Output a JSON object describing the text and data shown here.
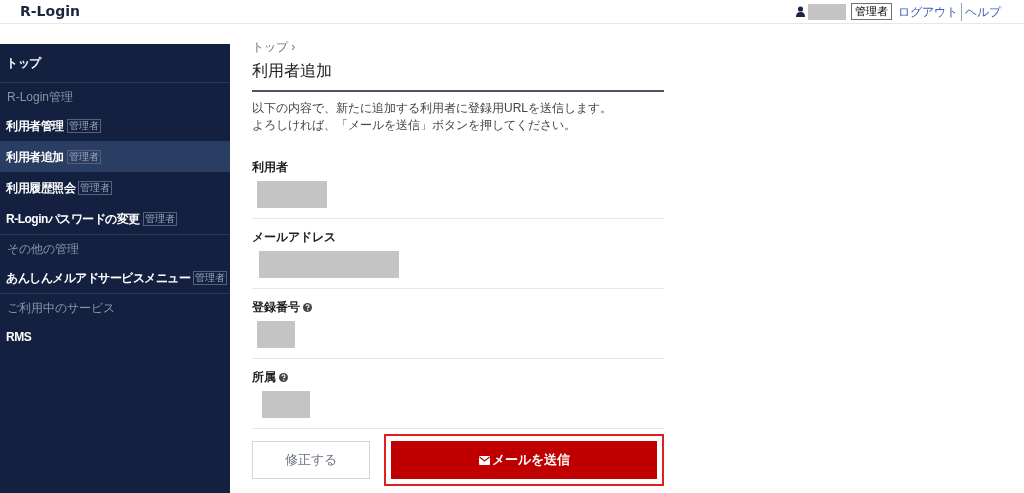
{
  "header": {
    "logo": "R-Login",
    "role_badge": "管理者",
    "links": [
      "ログアウト",
      "ヘルプ"
    ]
  },
  "sidebar": {
    "items": [
      {
        "kind": "link",
        "label": "トップ",
        "selected": false
      },
      {
        "kind": "section",
        "label": "R-Login管理"
      },
      {
        "kind": "link",
        "label": "利用者管理",
        "badge": "管理者",
        "selected": false
      },
      {
        "kind": "link",
        "label": "利用者追加",
        "badge": "管理者",
        "selected": true
      },
      {
        "kind": "link",
        "label": "利用履歴照会",
        "badge": "管理者",
        "selected": false
      },
      {
        "kind": "link",
        "label": "R-Loginパスワードの変更",
        "badge": "管理者",
        "selected": false
      },
      {
        "kind": "section",
        "label": "その他の管理"
      },
      {
        "kind": "link",
        "label": "あんしんメルアドサービスメニュー",
        "badge": "管理者",
        "selected": false
      },
      {
        "kind": "section",
        "label": "ご利用中のサービス"
      },
      {
        "kind": "link",
        "label": "RMS",
        "selected": false
      }
    ]
  },
  "breadcrumb": [
    "トップ ›"
  ],
  "page_title": "利用者追加",
  "description": [
    "以下の内容で、新たに追加する利用者に登録用URLを送信します。",
    "よろしければ、「メールを送信」ボタンを押してください。"
  ],
  "fields": [
    {
      "label": "利用者",
      "help": false
    },
    {
      "label": "メールアドレス",
      "help": false
    },
    {
      "label": "登録番号",
      "help": true
    },
    {
      "label": "所属",
      "help": true
    }
  ],
  "buttons": [
    {
      "kind": "secondary",
      "label": "修正する"
    },
    {
      "kind": "primary",
      "label": "メールを送信",
      "highlighted": true
    }
  ]
}
